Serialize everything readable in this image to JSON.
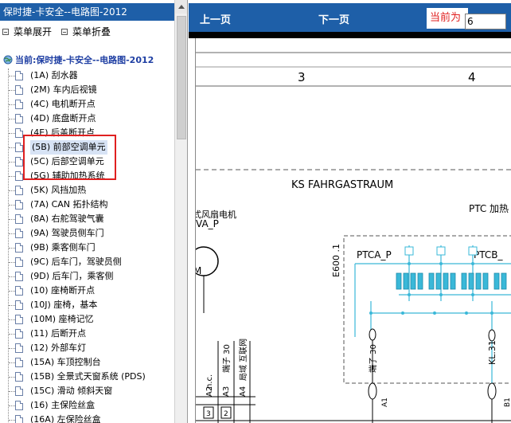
{
  "left_panel": {
    "title": "保时捷-卡安全--电路图-2012",
    "menu_expand": "菜单展开",
    "menu_collapse": "菜单折叠",
    "tree_root": "当前:保时捷-卡安全--电路图-2012",
    "items": [
      "(1A) 刮水器",
      "(2M) 车内后视镜",
      "(4C) 电机断开点",
      "(4D) 底盘断开点",
      "(4E) 后盖断开点",
      "(5B) 前部空调单元",
      "(5C) 后部空调单元",
      "(5G) 辅助加热系统",
      "(5K) 风挡加热",
      "(7A) CAN 拓扑结构",
      "(8A) 右舵驾驶气囊",
      "(9A) 驾驶员侧车门",
      "(9B) 乘客侧车门",
      "(9C) 后车门，驾驶员侧",
      "(9D) 后车门，乘客侧",
      "(10) 座椅断开点",
      "(10J) 座椅，基本",
      "(10M) 座椅记忆",
      "(11) 后断开点",
      "(12) 外部车灯",
      "(15A) 车顶控制台",
      "(15B) 全景式天窗系统 (PDS)",
      "(15C) 滑动 倾斜天窗",
      "(16) 主保险丝盒",
      "(16A) 左保险丝盒"
    ],
    "selected_index": 5
  },
  "toolbar": {
    "prev_label": "上一页",
    "next_label": "下一页",
    "page_label": "当前为",
    "page_value": "6"
  },
  "diagram": {
    "col3": "3",
    "col4": "4",
    "area_title": "KS FAHRGASTRAUM",
    "ptc_heat": "PTC 加热",
    "motor_label": "式风扇电机",
    "va_p": "VA_P",
    "m_label": "M",
    "e600": "E600 .1",
    "ptca_p": "PTCA_P",
    "ptcb_p": "PTCB_",
    "nc": "n.c.",
    "term30a": "端子 30",
    "ground_label": "局域 互联网",
    "term30b": "端子 30",
    "kl31": "KL.31",
    "a2": "A2",
    "a3": "A3",
    "a4": "A4",
    "a1": "A1",
    "b1": "B1",
    "n3": "3",
    "n2": "2"
  },
  "colors": {
    "header_blue": "#1e5fa8",
    "highlight_red": "#e02020",
    "wire_cyan": "#3ab8d8"
  }
}
